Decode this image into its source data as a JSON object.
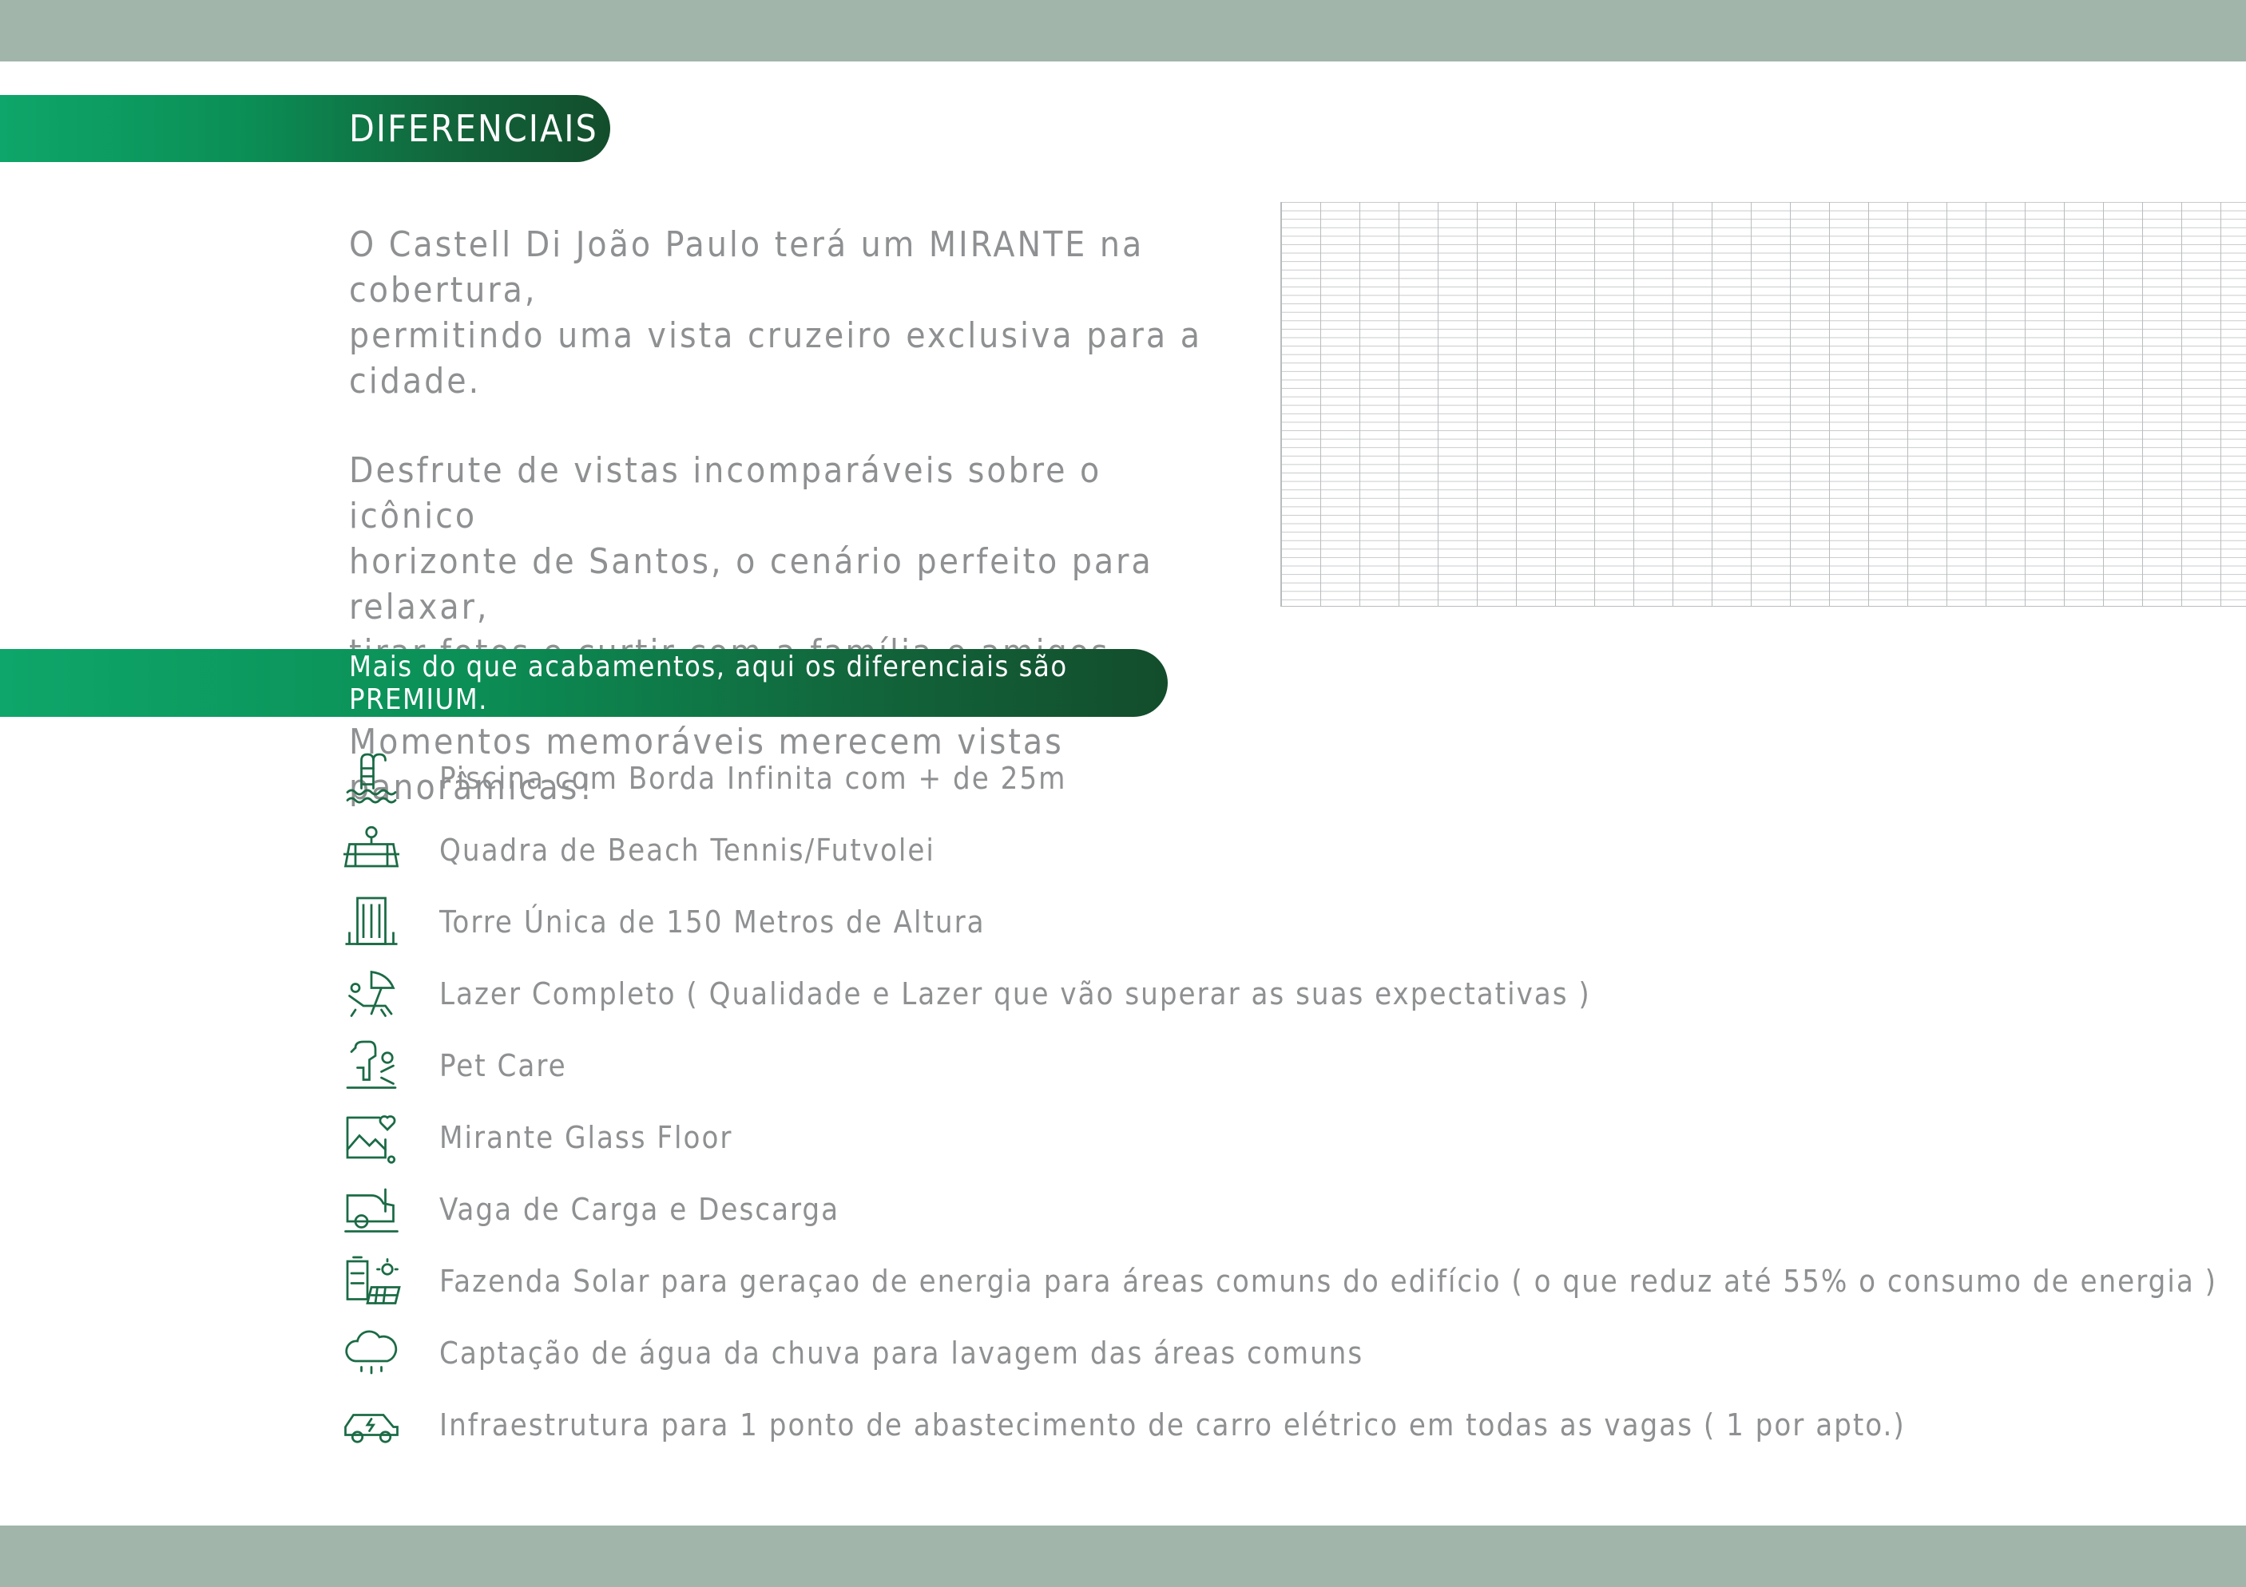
{
  "heading": "DIFERENCIAIS",
  "intro": {
    "paragraphs": [
      "O Castell Di João Paulo terá um MIRANTE na cobertura,\npermitindo uma vista cruzeiro exclusiva para a cidade.",
      "Desfrute de vistas incomparáveis sobre o icônico\nhorizonte de Santos, o cenário perfeito para relaxar,\ntirar fotos e curtir com a família e amigos.",
      "Momentos memoráveis merecem vistas panorâmicas!"
    ]
  },
  "premium_banner": "Mais do que acabamentos, aqui os diferenciais são PREMIUM.",
  "features": [
    {
      "icon": "pool-ladder-icon",
      "label": "Piscina com Borda Infinita com + de 25m"
    },
    {
      "icon": "beach-tennis-court-icon",
      "label": "Quadra de Beach Tennis/Futvolei"
    },
    {
      "icon": "tower-building-icon",
      "label": "Torre  Única de 150 Metros de Altura"
    },
    {
      "icon": "beach-lounger-umbrella-icon",
      "label": "Lazer Completo ( Qualidade e Lazer que vão superar as suas expectativas )"
    },
    {
      "icon": "pet-care-icon",
      "label": "Pet Care"
    },
    {
      "icon": "landscape-heart-icon",
      "label": "Mirante Glass Floor"
    },
    {
      "icon": "car-loading-icon",
      "label": "Vaga de Carga e Descarga"
    },
    {
      "icon": "solar-panel-battery-icon",
      "label": "Fazenda Solar para geraçao de energia para áreas comuns do edifício ( o que reduz até 55% o consumo de energia )"
    },
    {
      "icon": "rain-cloud-icon",
      "label": "Captação de água da chuva para lavagem das áreas comuns"
    },
    {
      "icon": "electric-car-icon",
      "label": "Infraestrutura para 1 ponto de abastecimento de carro elétrico em todas as vagas ( 1 por apto.)"
    }
  ],
  "colors": {
    "band": "#a1b5aa",
    "accent_green_light": "#0ea66a",
    "accent_green_dark": "#134d2c",
    "text_gray": "#8e9092",
    "icon_green": "#1b6b45"
  }
}
